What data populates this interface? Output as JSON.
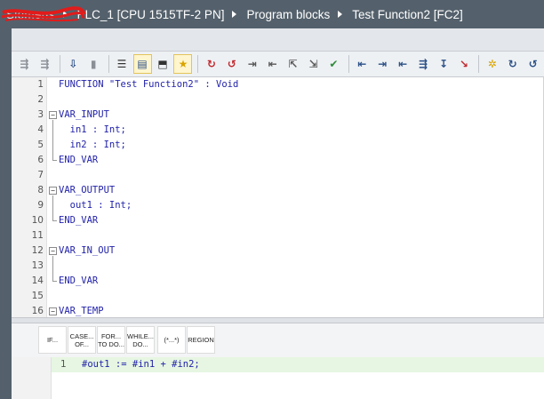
{
  "breadcrumb": {
    "project": "Siemens",
    "items": [
      "PLC_1 [CPU 1515TF-2 PN]",
      "Program blocks",
      "Test Function2 [FC2]"
    ]
  },
  "toolbar": {
    "icons": [
      "insert-row-icon",
      "add-row-icon",
      "download-icon",
      "go-online-icon",
      "absolute-operands-icon",
      "interface-toggle-icon",
      "monitor-download-icon",
      "favorites-icon",
      "toggle-breakpoint-icon",
      "delete-breakpoints-icon",
      "step-over-icon",
      "step-into-icon",
      "step-out-icon",
      "run-to-icon",
      "check-consistency-icon",
      "indent-icon",
      "outdent-icon",
      "comment-icon",
      "uncomment-icon",
      "show-all-icon",
      "go-to-icon",
      "bookmark-next-icon",
      "bookmark-prev-icon",
      "more-icon"
    ]
  },
  "interface": {
    "lines": [
      {
        "n": "1",
        "text": "FUNCTION \"Test Function2\" : Void"
      },
      {
        "n": "2",
        "text": ""
      },
      {
        "n": "3",
        "text": "VAR_INPUT"
      },
      {
        "n": "4",
        "text": "  in1 : Int;"
      },
      {
        "n": "5",
        "text": "  in2 : Int;"
      },
      {
        "n": "6",
        "text": "END_VAR"
      },
      {
        "n": "7",
        "text": ""
      },
      {
        "n": "8",
        "text": "VAR_OUTPUT"
      },
      {
        "n": "9",
        "text": "  out1 : Int;"
      },
      {
        "n": "10",
        "text": "END_VAR"
      },
      {
        "n": "11",
        "text": ""
      },
      {
        "n": "12",
        "text": "VAR_IN_OUT"
      },
      {
        "n": "13",
        "text": ""
      },
      {
        "n": "14",
        "text": "END_VAR"
      },
      {
        "n": "15",
        "text": ""
      },
      {
        "n": "16",
        "text": "VAR_TEMP"
      }
    ]
  },
  "instructions": [
    "IF...",
    "CASE...\nOF...",
    "FOR...\nTO DO...",
    "WHILE...\nDO...",
    "(*...*)",
    "REGION"
  ],
  "editor": {
    "line_number": "1",
    "code": "#out1 := #in1 + #in2;"
  },
  "colors": {
    "titlebar": "#54616c",
    "keyword": "#2222aa",
    "current_line": "#e6f6e2"
  }
}
